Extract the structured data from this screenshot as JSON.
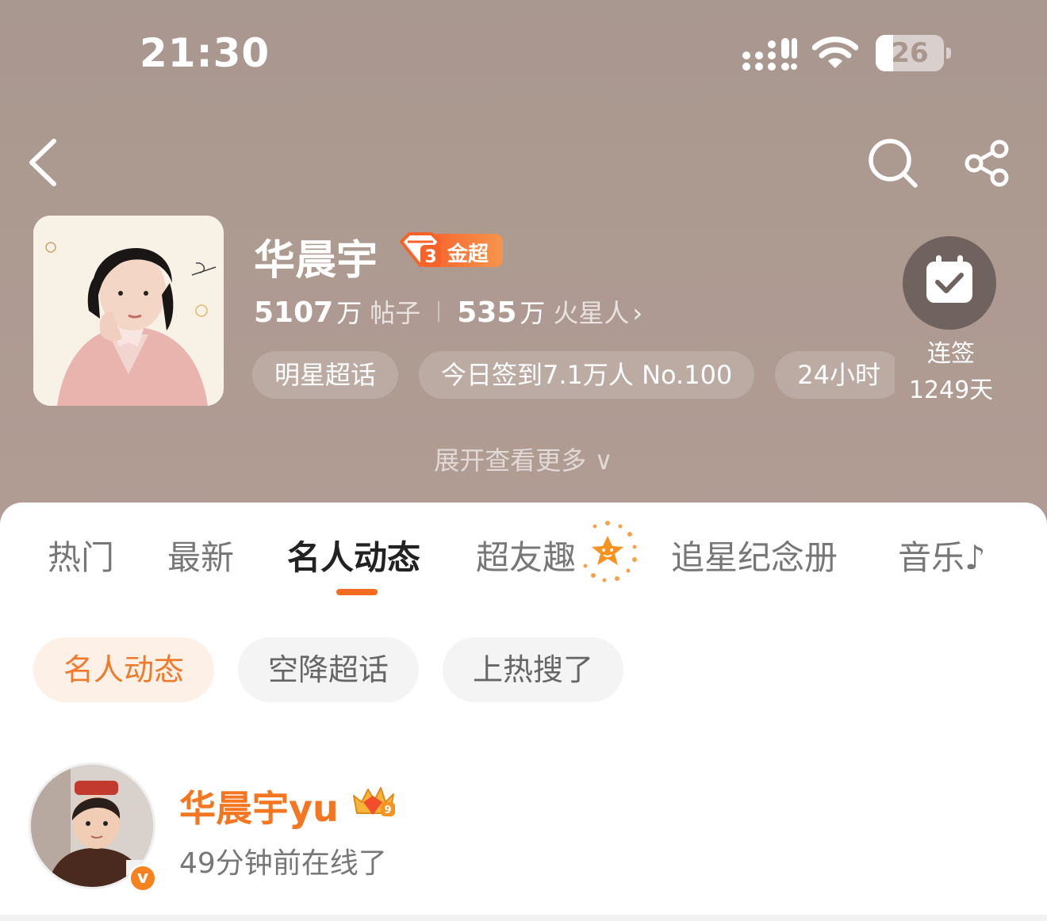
{
  "status_bar": {
    "time": "21:30",
    "battery_level": "26",
    "battery_fraction": 0.26
  },
  "nav": {
    "back_icon": "chevron-left-icon",
    "search_icon": "search-icon",
    "share_icon": "share-icon"
  },
  "topic": {
    "title": "华晨宇",
    "badge_level": "3",
    "badge_label": "金超",
    "posts_count": "5107",
    "posts_unit": "万",
    "posts_label": "帖子",
    "fans_count": "535",
    "fans_unit": "万",
    "fans_label": "火星人",
    "fans_arrow": "›",
    "tags": [
      "明星超话",
      "今日签到7.1万人 No.100",
      "24小时"
    ],
    "checkin_label": "连签",
    "checkin_days": "1249天",
    "expand_label": "展开查看更多 ∨"
  },
  "tabs": [
    {
      "label": "热门"
    },
    {
      "label": "最新"
    },
    {
      "label": "名人动态"
    },
    {
      "label": "超友趣"
    },
    {
      "label": "追星纪念册"
    },
    {
      "label": "音乐♪"
    }
  ],
  "active_tab": "名人动态",
  "chips": [
    {
      "label": "名人动态"
    },
    {
      "label": "空降超话"
    },
    {
      "label": "上热搜了"
    }
  ],
  "post": {
    "username": "华晨宇yu",
    "verified_mark": "v",
    "status": "49分钟前在线了"
  },
  "colors": {
    "accent": "#f56b20",
    "header_bg": "#ad9a91",
    "chip_active_bg": "#fdf1e7"
  }
}
